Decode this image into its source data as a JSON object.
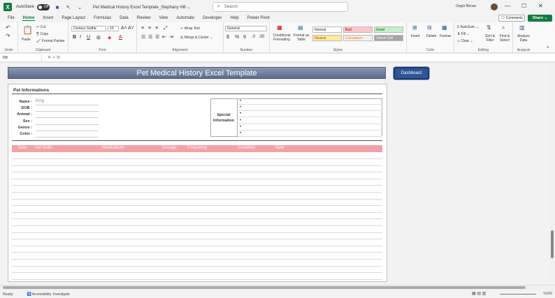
{
  "titlebar": {
    "autosave_label": "AutoSave",
    "autosave_state": "Off",
    "doc_title": "Pet Medical History Excel Template_Stephany Hill ⌄",
    "search_placeholder": "Search",
    "user_name": "Ozgür Bircan"
  },
  "menu": [
    "File",
    "Home",
    "Insert",
    "Page Layout",
    "Formulas",
    "Data",
    "Review",
    "View",
    "Automate",
    "Developer",
    "Help",
    "Power Pivot"
  ],
  "menu_active": "Home",
  "comments_label": "Comments",
  "share_label": "Share",
  "ribbon": {
    "undo_label": "Undo",
    "clipboard": {
      "label": "Clipboard",
      "paste": "Paste",
      "cut": "Cut",
      "copy": "Copy",
      "format_painter": "Format Painter"
    },
    "font": {
      "label": "Font",
      "name": "Century Gothic",
      "size": "10"
    },
    "alignment": {
      "label": "Alignment",
      "wrap": "Wrap Text",
      "merge": "Merge & Center"
    },
    "number": {
      "label": "Number",
      "format": "General"
    },
    "styles": {
      "label": "Styles",
      "conditional": "Conditional Formatting",
      "format_table": "Format as Table",
      "cells": [
        {
          "name": "Normal",
          "bg": "#ffffff",
          "fg": "#222222"
        },
        {
          "name": "Bad",
          "bg": "#ffc7ce",
          "fg": "#9c0006"
        },
        {
          "name": "Good",
          "bg": "#c6efce",
          "fg": "#006100"
        },
        {
          "name": "Neutral",
          "bg": "#ffeb9c",
          "fg": "#9c5700"
        },
        {
          "name": "Calculation",
          "bg": "#f2f2f2",
          "fg": "#fa7d00"
        },
        {
          "name": "Check Cell",
          "bg": "#a5a5a5",
          "fg": "#ffffff"
        }
      ]
    },
    "cells": {
      "label": "Cells",
      "insert": "Insert",
      "delete": "Delete",
      "format": "Format"
    },
    "editing": {
      "label": "Editing",
      "autosum": "AutoSum",
      "fill": "Fill",
      "clear": "Clear",
      "sort": "Sort & Filter",
      "find": "Find & Select"
    },
    "analysis": {
      "label": "Analysis",
      "analyze": "Analyze Data"
    }
  },
  "formula_bar": {
    "name_box": "I58",
    "fx": "✕  ✓  fx"
  },
  "sheet": {
    "title": "Pet Medical History Excel Template",
    "dashboard_button": "Dashboard",
    "section_title": "Pet Informations",
    "fields": [
      {
        "label": "Name :",
        "value": "King"
      },
      {
        "label": "DOB :",
        "value": ""
      },
      {
        "label": "Animal :",
        "value": ""
      },
      {
        "label": "Sex :",
        "value": ""
      },
      {
        "label": "Genus :",
        "value": ""
      },
      {
        "label": "Color :",
        "value": ""
      }
    ],
    "special_label": "Special Information",
    "special_bullets": [
      "•",
      "•",
      "•",
      "•",
      "•",
      "•"
    ],
    "table_headers": [
      "Date",
      "Vet Visits",
      "Medications",
      "Dosage",
      "Frequency",
      "Condition",
      "Note"
    ],
    "table_row_count": 19
  },
  "status": {
    "ready": "Ready",
    "accessibility": "Accessibility: Investigate",
    "zoom": "%100"
  }
}
